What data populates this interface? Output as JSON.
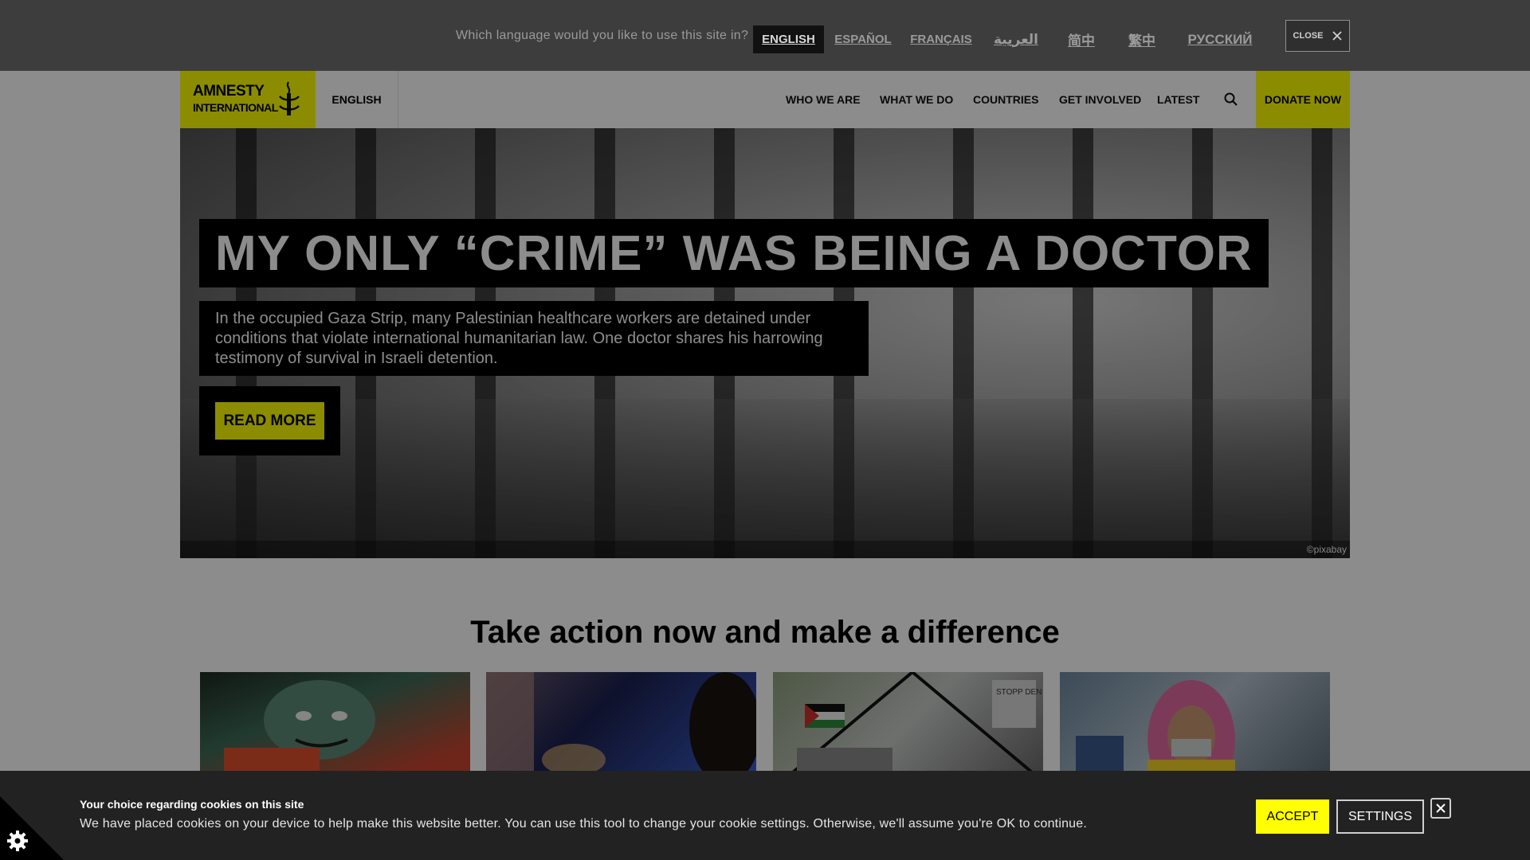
{
  "language_bar": {
    "question": "Which language would you like to use this site in?",
    "languages": [
      {
        "label": "ENGLISH",
        "active": true
      },
      {
        "label": "ESPAÑOL",
        "active": false
      },
      {
        "label": "FRANÇAIS",
        "active": false
      },
      {
        "label": "العربية",
        "active": false
      },
      {
        "label": "简中",
        "active": false
      },
      {
        "label": "繁中",
        "active": false
      },
      {
        "label": "РУССКИЙ",
        "active": false
      }
    ],
    "close_label": "CLOSE",
    "close_icon": "close-icon"
  },
  "header": {
    "logo_line1": "AMNESTY",
    "logo_line2": "INTERNATIONAL",
    "logo_icon": "candle-icon",
    "language": "ENGLISH",
    "nav": [
      "WHO WE ARE",
      "WHAT WE DO",
      "COUNTRIES",
      "GET INVOLVED",
      "LATEST"
    ],
    "search_icon": "search-icon",
    "donate_label": "DONATE NOW",
    "brand_color": "#ffff00"
  },
  "hero": {
    "title": "MY ONLY “CRIME” WAS BEING A DOCTOR",
    "description_lines": [
      "In the occupied Gaza Strip, many Palestinian healthcare workers are detained under",
      "conditions that violate international humanitarian law. One doctor shares his harrowing",
      "testimony of survival in Israeli detention."
    ],
    "button_label": "READ MORE",
    "credit": "©pixabay"
  },
  "action_section": {
    "title": "Take action now and make a difference",
    "cards": [
      {
        "image": "illustration-card"
      },
      {
        "image": "night-vigil-card"
      },
      {
        "image": "gaza-protest-card",
        "image_text": "STOPP DEN GENO"
      },
      {
        "image": "garment-worker-card"
      }
    ]
  },
  "cookie_banner": {
    "title": "Your choice regarding cookies on this site",
    "text": "We have placed cookies on your device to help make this website better. You can use this tool to change your cookie settings. Otherwise, we'll assume you're OK to continue.",
    "accept_label": "ACCEPT",
    "settings_label": "SETTINGS",
    "close_icon": "close-icon",
    "gear_icon": "cookie-settings-icon"
  }
}
